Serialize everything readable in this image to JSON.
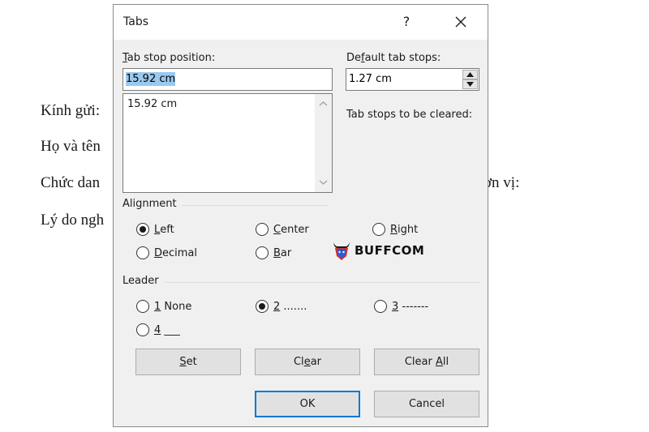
{
  "document": {
    "lines": [
      "Kính gửi:",
      "Họ và tên",
      "Chức dan",
      "Lý do ngh"
    ],
    "right_fragment": "ơn vị:"
  },
  "dialog": {
    "title": "Tabs",
    "help_label": "?",
    "tab_stop_position": {
      "label_mnemonic": "T",
      "label_rest": "ab stop position:",
      "value": "15.92 cm",
      "list_items": [
        "15.92 cm"
      ]
    },
    "default_tab_stops": {
      "label_pre": "De",
      "label_mnemonic": "f",
      "label_rest": "ault tab stops:",
      "value": "1.27 cm"
    },
    "tab_stops_to_be_cleared_label": "Tab stops to be cleared:",
    "alignment": {
      "title": "Alignment",
      "options": [
        {
          "mnemonic": "L",
          "rest": "eft",
          "checked": true
        },
        {
          "mnemonic": "C",
          "rest": "enter",
          "checked": false
        },
        {
          "mnemonic": "R",
          "rest": "ight",
          "checked": false
        },
        {
          "mnemonic": "D",
          "rest": "ecimal",
          "checked": false
        },
        {
          "mnemonic": "B",
          "rest": "ar",
          "checked": false
        }
      ]
    },
    "leader": {
      "title": "Leader",
      "options": [
        {
          "mnemonic": "1",
          "rest": " None",
          "checked": false
        },
        {
          "mnemonic": "2",
          "rest": " .......",
          "checked": true
        },
        {
          "mnemonic": "3",
          "rest": " -------",
          "checked": false
        },
        {
          "mnemonic": "4",
          "rest": " ___",
          "checked": false
        }
      ]
    },
    "buttons": {
      "set": {
        "pre": "",
        "mnemonic": "S",
        "rest": "et"
      },
      "clear": {
        "pre": "Cl",
        "mnemonic": "e",
        "rest": "ar"
      },
      "clear_all": {
        "pre": "Clear ",
        "mnemonic": "A",
        "rest": "ll"
      },
      "ok": "OK",
      "cancel": "Cancel"
    }
  },
  "watermark": {
    "text": "BUFFCOM"
  },
  "colors": {
    "accent": "#0078d7",
    "selection": "#99c9ef",
    "dialog_bg": "#f0f0f0"
  }
}
